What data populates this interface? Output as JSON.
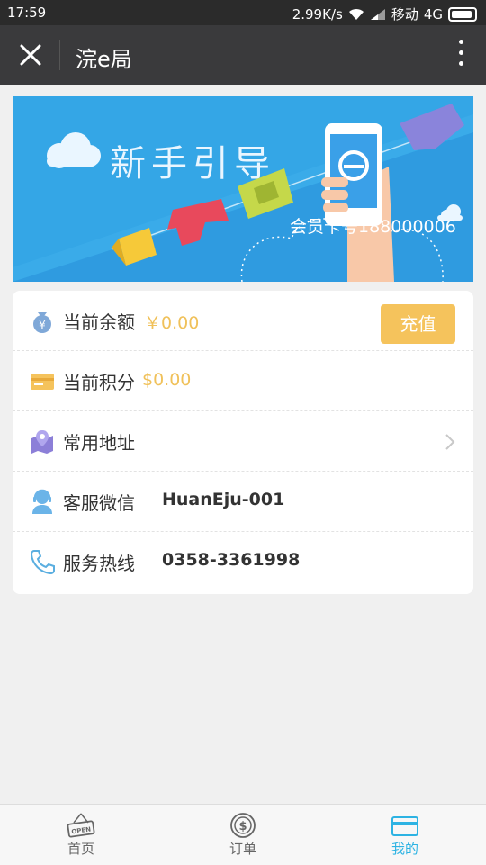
{
  "status_bar": {
    "time": "17:59",
    "net_speed": "2.99K/s",
    "carrier": "移动",
    "network": "4G"
  },
  "nav": {
    "title": "浣e局"
  },
  "banner": {
    "title": "新手引导",
    "member_text": "会员卡号188000006"
  },
  "account": {
    "balance": {
      "label": "当前余额",
      "value": "￥0.00",
      "button": "充值"
    },
    "points": {
      "label": "当前积分",
      "value": "$0.00"
    },
    "address": {
      "label": "常用地址"
    },
    "wechat": {
      "label": "客服微信",
      "value": "HuanEju-001"
    },
    "hotline": {
      "label": "服务热线",
      "value": "0358-3361998"
    }
  },
  "tabs": [
    {
      "label": "首页",
      "icon": "open-sign-icon",
      "active": false
    },
    {
      "label": "订单",
      "icon": "dollar-coin-icon",
      "active": false
    },
    {
      "label": "我的",
      "icon": "card-icon",
      "active": true
    }
  ],
  "colors": {
    "accent_gold": "#f5c35c",
    "tab_active": "#2db3e3",
    "banner_blue": "#34a6e6"
  }
}
